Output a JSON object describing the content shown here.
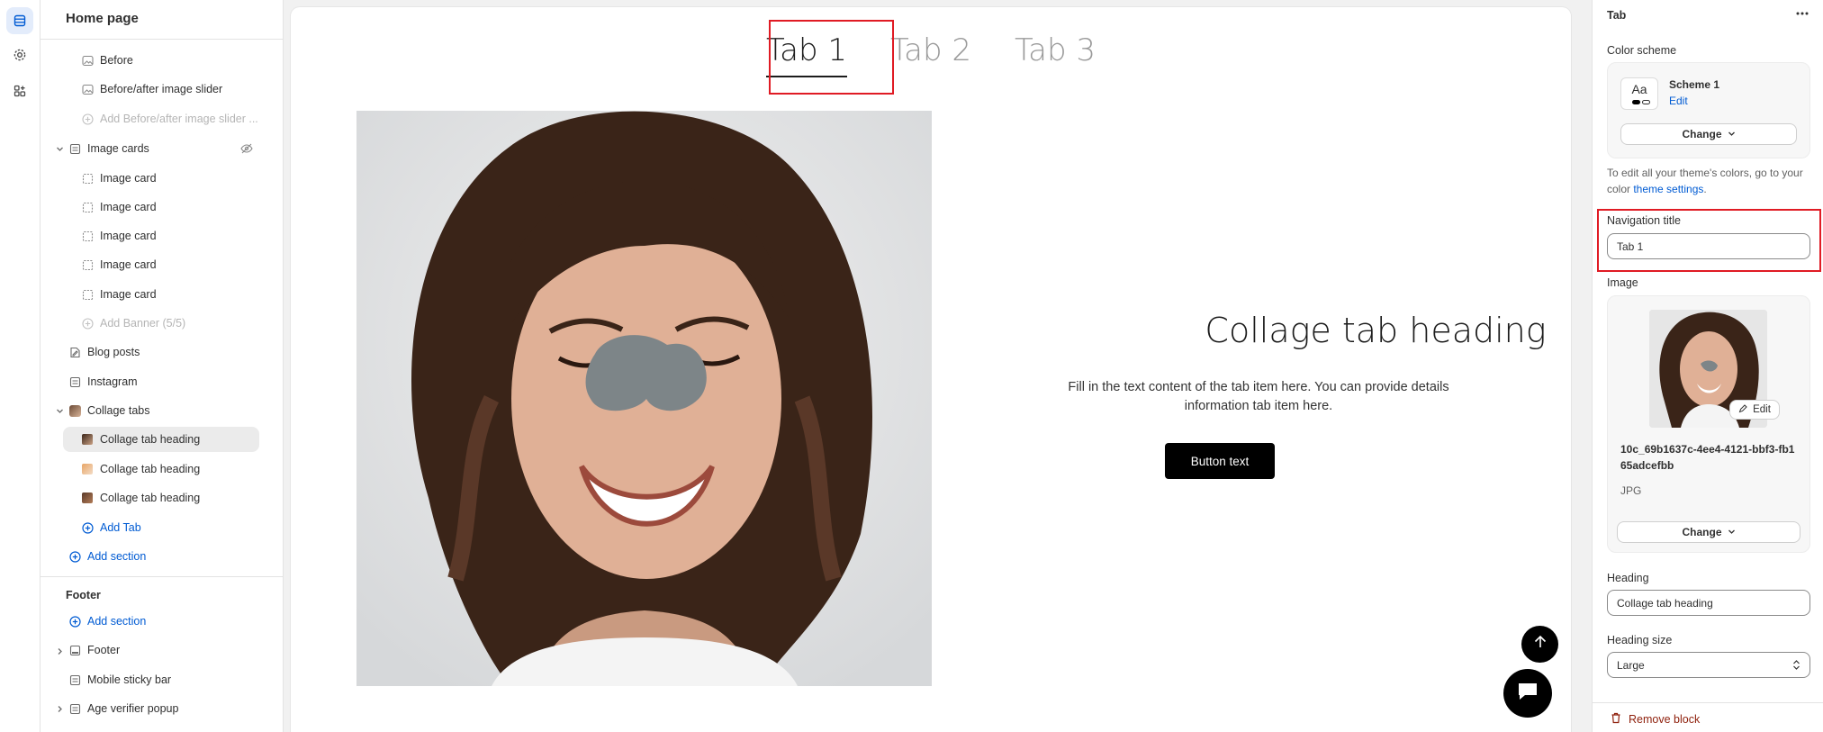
{
  "left_sidebar": {
    "title": "Home page",
    "items": [
      {
        "label": "Before",
        "icon": "image-icon",
        "state": "child"
      },
      {
        "label": "Before/after image slider",
        "icon": "image-icon",
        "state": "child"
      },
      {
        "label": "Add Before/after image slider ...",
        "icon": "add-circle-icon",
        "state": "disabled"
      },
      {
        "label": "Image cards",
        "icon": "section-icon",
        "state": "section"
      },
      {
        "label": "Image card",
        "icon": "frame-icon",
        "state": "child"
      },
      {
        "label": "Image card",
        "icon": "frame-icon",
        "state": "child"
      },
      {
        "label": "Image card",
        "icon": "frame-icon",
        "state": "child"
      },
      {
        "label": "Image card",
        "icon": "frame-icon",
        "state": "child"
      },
      {
        "label": "Image card",
        "icon": "frame-icon",
        "state": "child"
      },
      {
        "label": "Add Banner (5/5)",
        "icon": "add-circle-icon",
        "state": "disabled"
      },
      {
        "label": "Blog posts",
        "icon": "blog-icon",
        "state": "section"
      },
      {
        "label": "Instagram",
        "icon": "section-icon",
        "state": "section"
      },
      {
        "label": "Collage tabs",
        "icon": "thumb-icon",
        "state": "section"
      },
      {
        "label": "Collage tab heading",
        "icon": "thumb-icon",
        "state": "selected"
      },
      {
        "label": "Collage tab heading",
        "icon": "thumb-icon",
        "state": "child"
      },
      {
        "label": "Collage tab heading",
        "icon": "thumb-icon",
        "state": "child"
      },
      {
        "label": "Add Tab",
        "icon": "add-circle-icon",
        "state": "link"
      },
      {
        "label": "Add section",
        "icon": "add-circle-icon",
        "state": "link"
      }
    ],
    "footer_group": {
      "title": "Footer",
      "add_section": "Add section",
      "items": [
        "Footer",
        "Mobile sticky bar",
        "Age verifier popup"
      ]
    }
  },
  "preview": {
    "tabs": [
      "Tab 1",
      "Tab 2",
      "Tab 3"
    ],
    "active_tab": "Tab 1",
    "heading": "Collage tab heading",
    "text": "Fill in the text content of the tab item here. You can provide details information tab item here.",
    "button": "Button text"
  },
  "settings": {
    "title": "Tab",
    "color_scheme": {
      "label": "Color scheme",
      "name": "Scheme 1",
      "edit": "Edit",
      "swatch": "Aa",
      "change": "Change"
    },
    "hint_prefix": "To edit all your theme's colors, go to your color ",
    "hint_link": "theme settings",
    "hint_suffix": ".",
    "navigation_title": {
      "label": "Navigation title",
      "value": "Tab 1"
    },
    "image": {
      "label": "Image",
      "filename": "10c_69b1637c-4ee4-4121-bbf3-fb165adcefbb",
      "type": "JPG",
      "edit": "Edit",
      "change": "Change"
    },
    "heading": {
      "label": "Heading",
      "value": "Collage tab heading"
    },
    "heading_size": {
      "label": "Heading size",
      "value": "Large"
    },
    "remove": "Remove block"
  },
  "colors": {
    "accent": "#005bd3",
    "highlight": "#e01b24",
    "danger": "#8e1f0b"
  }
}
